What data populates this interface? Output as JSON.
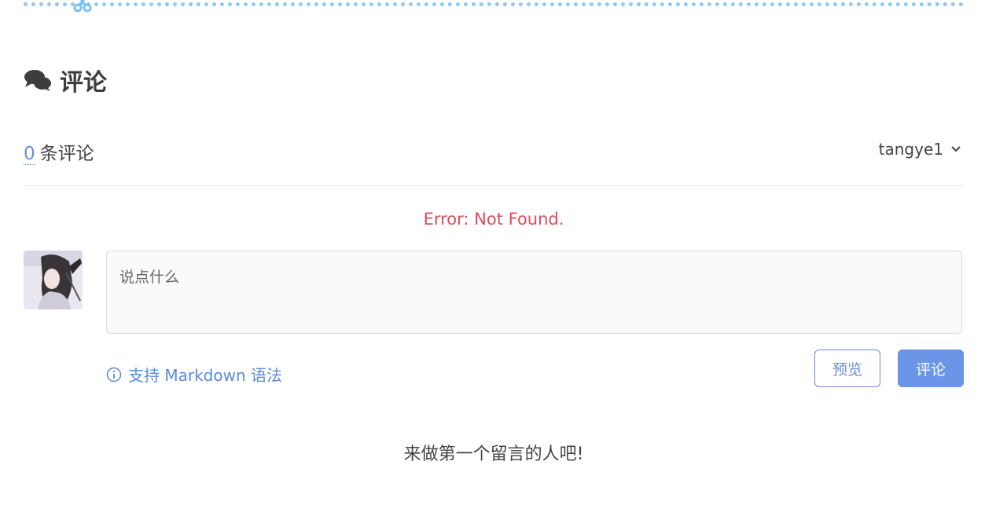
{
  "section": {
    "title": "评论",
    "icon": "comments-icon"
  },
  "comments": {
    "count": "0",
    "count_label": "条评论",
    "empty_message": "来做第一个留言的人吧!"
  },
  "user": {
    "name": "tangye1",
    "menu_icon": "chevron-down-icon"
  },
  "error": {
    "message": "Error: Not Found."
  },
  "editor": {
    "placeholder": "说点什么",
    "value": "",
    "markdown_hint": "支持 Markdown 语法",
    "preview_label": "预览",
    "submit_label": "评论"
  },
  "colors": {
    "accent": "#6b8ed6",
    "submit_bg": "#6b96e8",
    "error": "#e04a5a",
    "divider_dots": "#8ec9f2"
  }
}
